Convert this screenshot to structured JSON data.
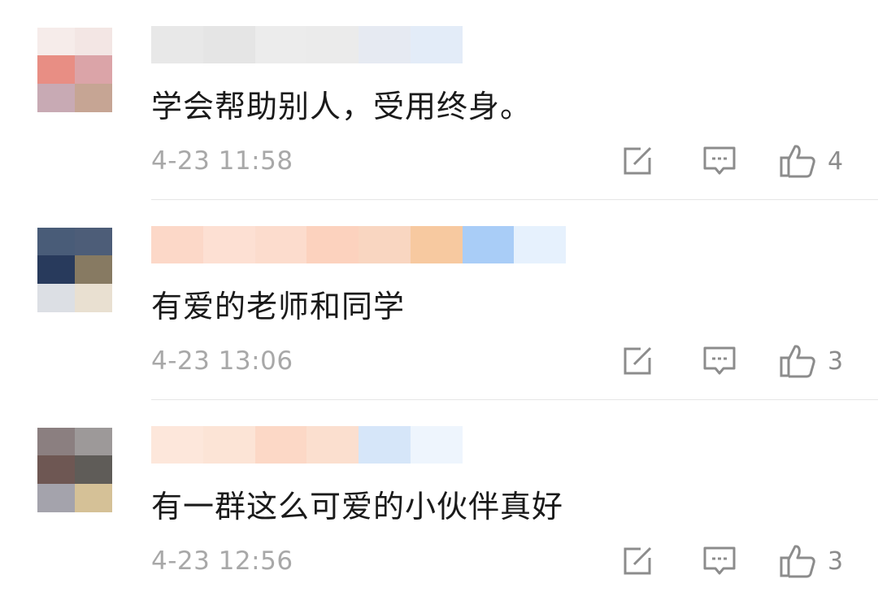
{
  "comments": [
    {
      "avatar_colors": [
        "#f6ecea",
        "#f3e6e4",
        "#e88e84",
        "#dba4a8",
        "#c8aab4",
        "#c6a594"
      ],
      "name_blur_colors": [
        "#e8e8e8",
        "#e5e5e5",
        "#ececec",
        "#ebebeb",
        "#e6eaf2",
        "#e3ecf8",
        "#ffffff",
        "#ffffff"
      ],
      "text": "学会帮助别人，受用终身。",
      "time": "4-23 11:58",
      "likes": "4"
    },
    {
      "avatar_colors": [
        "#495c78",
        "#4d5d78",
        "#283a5c",
        "#877a62",
        "#dcdfe4",
        "#e9e0d1"
      ],
      "name_blur_colors": [
        "#fcd8c8",
        "#fde0d3",
        "#fcdccd",
        "#fcd2be",
        "#f9d6c1",
        "#f7c9a0",
        "#a9cdf7",
        "#e6f1fd"
      ],
      "text": "有爱的老师和同学",
      "time": "4-23 13:06",
      "likes": "3"
    },
    {
      "avatar_colors": [
        "#8b7f80",
        "#9d9999",
        "#6e5753",
        "#5f5c58",
        "#a4a3ac",
        "#d5c197"
      ],
      "name_blur_colors": [
        "#fde7db",
        "#fce4d6",
        "#fcd8c6",
        "#fbdfcf",
        "#d6e6f9",
        "#eef5fd",
        "#ffffff",
        "#ffffff"
      ],
      "text": "有一群这么可爱的小伙伴真好",
      "time": "4-23 12:56",
      "likes": "3"
    }
  ],
  "icons": {
    "edit": "edit-icon",
    "reply": "reply-icon",
    "like": "thumbs-up-icon"
  }
}
